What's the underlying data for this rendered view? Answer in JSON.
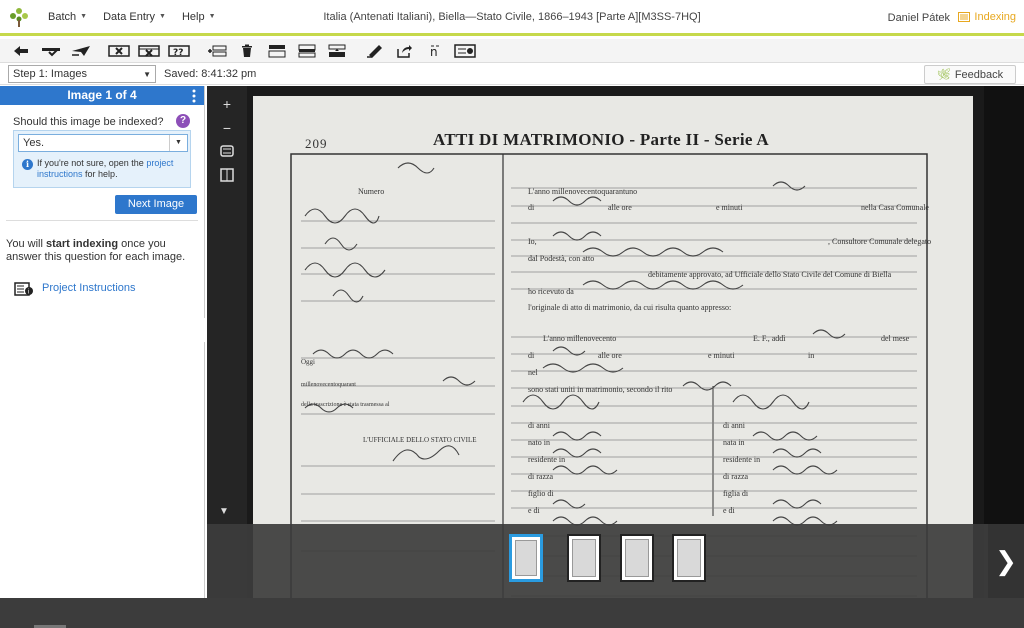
{
  "topnav": {
    "menus": [
      {
        "label": "Batch"
      },
      {
        "label": "Data Entry"
      },
      {
        "label": "Help"
      }
    ],
    "title": "Italia (Antenati Italiani), Biella—Stato Civile, 1866–1943 [Parte A][M3SS-7HQ]",
    "user": "Daniel Pátek",
    "indexing_label": "Indexing"
  },
  "toolbar": {
    "buttons": [
      "back",
      "check-line",
      "submit-plane",
      "field-x",
      "record-x",
      "unknown-field",
      "add-record",
      "delete",
      "insert-above",
      "insert-below",
      "sort",
      "highlight",
      "share",
      "ancestry-link",
      "keyboard"
    ]
  },
  "stepbar": {
    "step_select": "Step 1: Images",
    "saved": "Saved: 8:41:32 pm",
    "feedback": "Feedback"
  },
  "panel": {
    "header": "Image 1 of 4",
    "question": "Should this image be indexed?",
    "answer": "Yes.",
    "hint_prefix": "If you're not sure, open the",
    "hint_link": "project instructions",
    "hint_suffix": "for help.",
    "next_button": "Next Image",
    "start_text_1": "You will",
    "start_text_bold": "start indexing",
    "start_text_2": "once you answer this question for each image.",
    "project_instructions": "Project Instructions"
  },
  "viewer": {
    "doc_number": "209",
    "doc_title": "ATTI DI MATRIMONIO - Parte II - Serie A",
    "thumbnails": 4,
    "active_thumbnail": 1
  },
  "colors": {
    "accent_blue": "#2e77cc",
    "nav_underline": "#c6d94b",
    "indexing_orange": "#e8a81f",
    "help_purple": "#8d4fb8"
  }
}
